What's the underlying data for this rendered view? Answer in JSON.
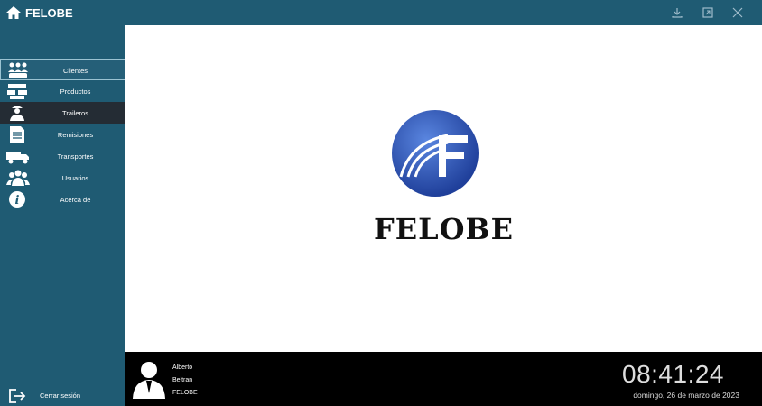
{
  "app": {
    "title": "FELOBE"
  },
  "window_controls": [
    "download-icon",
    "restore-icon",
    "close-icon"
  ],
  "sidebar": {
    "items": [
      {
        "label": "Clientes",
        "icon": "clients-icon",
        "state": "selected"
      },
      {
        "label": "Productos",
        "icon": "products-icon",
        "state": "normal"
      },
      {
        "label": "Traileros",
        "icon": "driver-icon",
        "state": "active"
      },
      {
        "label": "Remisiones",
        "icon": "document-icon",
        "state": "normal"
      },
      {
        "label": "Transportes",
        "icon": "truck-icon",
        "state": "normal"
      },
      {
        "label": "Usuarios",
        "icon": "users-icon",
        "state": "normal"
      },
      {
        "label": "Acerca de",
        "icon": "info-icon",
        "state": "normal"
      }
    ],
    "logout_label": "Cerrar sesión"
  },
  "main": {
    "brand_name": "FELOBE"
  },
  "status": {
    "user": {
      "first_name": "Alberto",
      "last_name": "Beltran",
      "company": "FELOBE"
    },
    "clock": "08:41:24",
    "date": "domingo, 26 de marzo de 2023"
  },
  "colors": {
    "sidebar_bg": "#1f5b73",
    "active_item_bg": "#242c34",
    "status_bg": "#000000",
    "logo_blue": "#2f5fc0"
  }
}
